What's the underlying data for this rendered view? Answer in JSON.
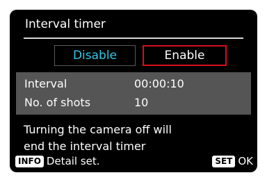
{
  "title": "Interval timer",
  "options": {
    "disable": "Disable",
    "enable": "Enable",
    "selected": "Enable"
  },
  "settings": [
    {
      "label": "Interval",
      "value": "00:00:10"
    },
    {
      "label": "No. of shots",
      "value": "10"
    }
  ],
  "message": {
    "line1": "Turning the camera off will",
    "line2": "end the interval timer"
  },
  "footer": {
    "info_key": "INFO",
    "info_label": "Detail set.",
    "set_key": "SET",
    "set_label": "OK"
  },
  "colors": {
    "background": "#000000",
    "disable_text": "#35c8e6",
    "selected_border": "#d6101a",
    "info_panel": "#555555"
  }
}
